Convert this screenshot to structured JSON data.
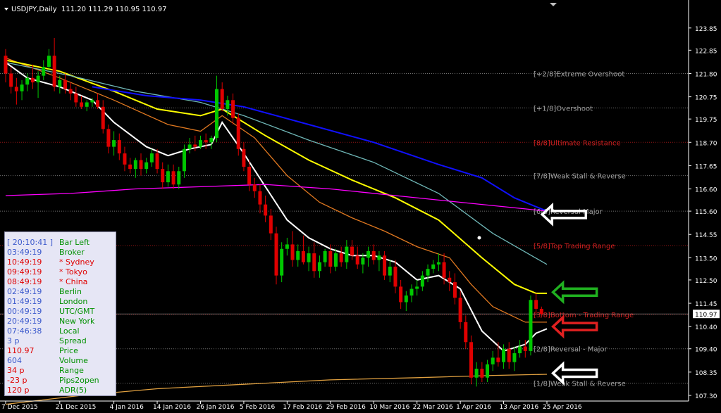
{
  "header": {
    "symbol_timeframe": "USDJPY,Daily",
    "ohlc": "111.20 111.29 110.95 110.97"
  },
  "colors": {
    "background": "#000000",
    "bull": "#00c800",
    "bear": "#e00000",
    "ma_fast": "#ffffff",
    "ma_orange": "#e07820",
    "ma_yellow": "#ffff00",
    "ma_teal": "#6fb7b7",
    "ma_blue": "#1010ff",
    "ma_magenta": "#ff00ff",
    "ma_long": "#e0a040",
    "axis_text": "#ffffff",
    "murrey_gray": "#a0a0a0",
    "murrey_red": "#d02020"
  },
  "chart_data": {
    "type": "candlestick",
    "y_range": [
      107.3,
      124.35
    ],
    "y_ticks": [
      123.85,
      122.85,
      121.8,
      120.75,
      119.75,
      118.7,
      117.65,
      116.6,
      115.6,
      114.55,
      113.5,
      112.5,
      111.45,
      110.4,
      109.4,
      108.35,
      107.3
    ],
    "y_tick_labels": [
      "123.85",
      "122.85",
      "121.80",
      "120.75",
      "119.75",
      "118.70",
      "117.65",
      "116.60",
      "115.60",
      "114.55",
      "113.50",
      "112.50",
      "111.45",
      "110.40",
      "109.40",
      "108.35",
      "107.30"
    ],
    "x_labels": [
      "7 Dec 2015",
      "21 Dec 2015",
      "4 Jan 2016",
      "14 Jan 2016",
      "26 Jan 2016",
      "5 Feb 2016",
      "17 Feb 2016",
      "29 Feb 2016",
      "10 Mar 2016",
      "22 Mar 2016",
      "1 Apr 2016",
      "13 Apr 2016",
      "25 Apr 2016"
    ],
    "x_label_index": [
      0,
      10,
      20,
      28,
      36,
      44,
      52,
      60,
      68,
      76,
      84,
      92,
      100
    ],
    "current_price": 110.97,
    "current_price_label": "110.97",
    "candles": [
      [
        122.6,
        122.9,
        121.4,
        121.8
      ],
      [
        121.8,
        122.1,
        120.9,
        121.2
      ],
      [
        121.2,
        121.6,
        120.4,
        121.0
      ],
      [
        121.0,
        121.5,
        120.6,
        121.3
      ],
      [
        121.3,
        121.8,
        121.0,
        121.6
      ],
      [
        121.6,
        122.2,
        121.1,
        121.4
      ],
      [
        121.4,
        121.9,
        120.7,
        121.7
      ],
      [
        121.7,
        122.4,
        121.5,
        122.1
      ],
      [
        122.1,
        122.9,
        121.9,
        122.6
      ],
      [
        122.6,
        123.4,
        121.0,
        121.2
      ],
      [
        121.2,
        121.7,
        120.9,
        121.5
      ],
      [
        121.5,
        121.8,
        120.9,
        121.1
      ],
      [
        121.1,
        121.4,
        120.6,
        120.9
      ],
      [
        120.9,
        121.2,
        120.3,
        120.5
      ],
      [
        120.5,
        120.8,
        120.2,
        120.3
      ],
      [
        120.3,
        120.6,
        120.1,
        120.5
      ],
      [
        120.5,
        120.7,
        120.3,
        120.6
      ],
      [
        120.6,
        120.9,
        120.2,
        120.3
      ],
      [
        120.3,
        120.6,
        119.1,
        119.3
      ],
      [
        119.3,
        119.5,
        118.2,
        118.5
      ],
      [
        118.5,
        119.2,
        118.1,
        118.8
      ],
      [
        118.8,
        119.1,
        117.9,
        118.2
      ],
      [
        118.2,
        118.5,
        117.4,
        117.7
      ],
      [
        117.7,
        118.0,
        117.3,
        117.5
      ],
      [
        117.5,
        118.0,
        117.1,
        117.9
      ],
      [
        117.9,
        118.2,
        117.2,
        117.5
      ],
      [
        117.5,
        118.0,
        117.3,
        117.8
      ],
      [
        117.8,
        118.4,
        117.6,
        118.2
      ],
      [
        118.2,
        118.4,
        117.3,
        117.5
      ],
      [
        117.5,
        117.8,
        116.6,
        116.9
      ],
      [
        116.9,
        117.7,
        116.7,
        117.4
      ],
      [
        117.4,
        117.7,
        116.6,
        116.8
      ],
      [
        116.8,
        117.6,
        116.6,
        117.4
      ],
      [
        117.4,
        118.6,
        117.1,
        118.4
      ],
      [
        118.4,
        118.9,
        118.2,
        118.6
      ],
      [
        118.6,
        119.0,
        118.3,
        118.5
      ],
      [
        118.5,
        119.0,
        118.4,
        118.8
      ],
      [
        118.8,
        119.1,
        118.4,
        118.7
      ],
      [
        118.7,
        119.0,
        118.4,
        118.9
      ],
      [
        118.9,
        121.7,
        118.7,
        121.1
      ],
      [
        121.1,
        121.4,
        120.1,
        120.2
      ],
      [
        120.2,
        120.8,
        119.9,
        120.6
      ],
      [
        120.6,
        120.9,
        119.5,
        119.8
      ],
      [
        119.8,
        120.0,
        118.1,
        118.4
      ],
      [
        118.4,
        118.7,
        117.4,
        117.6
      ],
      [
        117.6,
        117.9,
        116.5,
        116.8
      ],
      [
        116.8,
        117.1,
        116.2,
        116.5
      ],
      [
        116.5,
        116.8,
        115.5,
        115.9
      ],
      [
        115.9,
        116.3,
        115.1,
        115.4
      ],
      [
        115.4,
        115.7,
        114.3,
        114.6
      ],
      [
        114.6,
        114.9,
        112.3,
        112.7
      ],
      [
        112.7,
        114.2,
        112.4,
        113.9
      ],
      [
        113.9,
        114.4,
        113.6,
        114.1
      ],
      [
        114.1,
        114.7,
        113.1,
        113.4
      ],
      [
        113.4,
        114.1,
        113.1,
        113.8
      ],
      [
        113.8,
        114.5,
        113.2,
        113.3
      ],
      [
        113.3,
        114.0,
        112.9,
        113.7
      ],
      [
        113.7,
        114.2,
        112.6,
        112.9
      ],
      [
        112.9,
        113.6,
        112.6,
        113.3
      ],
      [
        113.3,
        113.9,
        113.1,
        113.8
      ],
      [
        113.8,
        114.1,
        112.8,
        113.1
      ],
      [
        113.1,
        113.9,
        112.9,
        113.7
      ],
      [
        113.7,
        114.0,
        113.1,
        113.3
      ],
      [
        113.3,
        114.3,
        113.0,
        114.0
      ],
      [
        114.0,
        114.3,
        113.4,
        113.6
      ],
      [
        113.6,
        114.0,
        113.0,
        113.2
      ],
      [
        113.2,
        113.7,
        112.8,
        113.5
      ],
      [
        113.5,
        114.0,
        113.1,
        113.8
      ],
      [
        113.8,
        114.1,
        113.2,
        113.4
      ],
      [
        113.4,
        113.8,
        112.9,
        113.6
      ],
      [
        113.6,
        113.8,
        112.5,
        112.7
      ],
      [
        112.7,
        113.4,
        112.4,
        113.1
      ],
      [
        113.1,
        113.4,
        111.9,
        112.2
      ],
      [
        112.2,
        112.5,
        111.2,
        111.5
      ],
      [
        111.5,
        112.0,
        111.1,
        111.8
      ],
      [
        111.8,
        112.3,
        111.5,
        112.1
      ],
      [
        112.1,
        112.5,
        111.8,
        112.2
      ],
      [
        112.2,
        112.9,
        112.0,
        112.7
      ],
      [
        112.7,
        113.2,
        112.4,
        113.0
      ],
      [
        113.0,
        113.4,
        112.8,
        113.2
      ],
      [
        113.2,
        113.7,
        112.9,
        113.3
      ],
      [
        113.3,
        113.7,
        112.3,
        112.6
      ],
      [
        112.6,
        112.9,
        112.0,
        112.4
      ],
      [
        112.4,
        112.8,
        111.4,
        111.7
      ],
      [
        111.7,
        112.0,
        110.3,
        110.6
      ],
      [
        110.6,
        110.9,
        109.4,
        109.7
      ],
      [
        109.7,
        110.0,
        107.8,
        108.1
      ],
      [
        108.1,
        108.8,
        107.7,
        108.5
      ],
      [
        108.5,
        108.8,
        107.9,
        108.1
      ],
      [
        108.1,
        108.9,
        107.9,
        108.7
      ],
      [
        108.7,
        109.3,
        108.4,
        109.0
      ],
      [
        109.0,
        109.7,
        108.6,
        108.8
      ],
      [
        108.8,
        109.6,
        108.5,
        109.4
      ],
      [
        109.4,
        109.7,
        108.5,
        108.8
      ],
      [
        108.8,
        109.5,
        108.4,
        109.2
      ],
      [
        109.2,
        109.8,
        109.0,
        109.5
      ],
      [
        109.5,
        109.8,
        109.0,
        109.3
      ],
      [
        109.3,
        111.8,
        109.1,
        111.6
      ],
      [
        111.6,
        111.9,
        110.9,
        111.2
      ],
      [
        111.2,
        111.3,
        110.9,
        110.97
      ]
    ],
    "moving_averages": [
      {
        "color_key": "ma_fast",
        "values": [
          [
            0,
            122.3
          ],
          [
            4,
            121.6
          ],
          [
            10,
            121.2
          ],
          [
            16,
            120.6
          ],
          [
            20,
            119.6
          ],
          [
            26,
            118.5
          ],
          [
            30,
            118.1
          ],
          [
            34,
            118.4
          ],
          [
            38,
            118.6
          ],
          [
            40,
            119.6
          ],
          [
            44,
            118.2
          ],
          [
            48,
            116.7
          ],
          [
            52,
            115.2
          ],
          [
            56,
            114.4
          ],
          [
            60,
            113.9
          ],
          [
            64,
            113.6
          ],
          [
            68,
            113.6
          ],
          [
            72,
            113.3
          ],
          [
            76,
            112.5
          ],
          [
            80,
            112.7
          ],
          [
            84,
            112.1
          ],
          [
            88,
            110.2
          ],
          [
            92,
            109.3
          ],
          [
            96,
            109.6
          ],
          [
            98,
            110.1
          ],
          [
            100,
            110.3
          ]
        ]
      },
      {
        "color_key": "ma_orange",
        "values": [
          [
            0,
            122.5
          ],
          [
            10,
            121.6
          ],
          [
            20,
            120.6
          ],
          [
            30,
            119.5
          ],
          [
            36,
            119.2
          ],
          [
            40,
            119.9
          ],
          [
            46,
            118.9
          ],
          [
            52,
            117.2
          ],
          [
            58,
            116.0
          ],
          [
            64,
            115.3
          ],
          [
            70,
            114.7
          ],
          [
            76,
            114.0
          ],
          [
            82,
            113.5
          ],
          [
            86,
            112.3
          ],
          [
            90,
            111.3
          ],
          [
            96,
            110.6
          ],
          [
            100,
            110.6
          ]
        ]
      },
      {
        "color_key": "ma_yellow",
        "values": [
          [
            0,
            122.4
          ],
          [
            10,
            121.9
          ],
          [
            20,
            121.0
          ],
          [
            28,
            120.2
          ],
          [
            36,
            119.9
          ],
          [
            40,
            120.2
          ],
          [
            48,
            119.0
          ],
          [
            56,
            117.9
          ],
          [
            64,
            117.0
          ],
          [
            72,
            116.2
          ],
          [
            80,
            115.2
          ],
          [
            88,
            113.5
          ],
          [
            94,
            112.3
          ],
          [
            98,
            111.9
          ],
          [
            100,
            111.9
          ]
        ]
      },
      {
        "color_key": "ma_teal",
        "values": [
          [
            0,
            122.3
          ],
          [
            12,
            121.7
          ],
          [
            24,
            121.0
          ],
          [
            36,
            120.5
          ],
          [
            44,
            119.9
          ],
          [
            56,
            118.8
          ],
          [
            68,
            117.8
          ],
          [
            80,
            116.4
          ],
          [
            90,
            114.6
          ],
          [
            100,
            113.2
          ]
        ]
      },
      {
        "color_key": "ma_blue",
        "values": [
          [
            16,
            121.2
          ],
          [
            26,
            120.8
          ],
          [
            36,
            120.6
          ],
          [
            44,
            120.3
          ],
          [
            56,
            119.5
          ],
          [
            68,
            118.7
          ],
          [
            80,
            117.7
          ],
          [
            88,
            117.1
          ],
          [
            94,
            116.2
          ],
          [
            100,
            115.6
          ]
        ]
      },
      {
        "color_key": "ma_magenta",
        "values": [
          [
            0,
            116.3
          ],
          [
            12,
            116.4
          ],
          [
            24,
            116.6
          ],
          [
            36,
            116.7
          ],
          [
            48,
            116.8
          ],
          [
            60,
            116.6
          ],
          [
            72,
            116.3
          ],
          [
            84,
            116.0
          ],
          [
            96,
            115.7
          ],
          [
            100,
            115.6
          ]
        ]
      },
      {
        "color_key": "ma_long",
        "values": [
          [
            0,
            106.9
          ],
          [
            14,
            107.3
          ],
          [
            28,
            107.6
          ],
          [
            44,
            107.8
          ],
          [
            60,
            108.0
          ],
          [
            76,
            108.1
          ],
          [
            90,
            108.2
          ],
          [
            100,
            108.25
          ]
        ]
      }
    ],
    "murrey_levels": [
      {
        "price": 121.8,
        "label": "[+2/8]Extreme Overshoot",
        "color_key": "murrey_gray"
      },
      {
        "price": 120.25,
        "label": "[+1/8]Overshoot",
        "color_key": "murrey_gray"
      },
      {
        "price": 118.7,
        "label": "[8/8]Ultimate Resistance",
        "color_key": "murrey_red"
      },
      {
        "price": 117.2,
        "label": "[7/8]Weak Stall & Reverse",
        "color_key": "murrey_gray"
      },
      {
        "price": 115.6,
        "label": "[6/8]Reversal Major",
        "color_key": "murrey_gray"
      },
      {
        "price": 114.05,
        "label": "[5/8]Top Trading Range",
        "color_key": "murrey_red"
      },
      {
        "price": 110.95,
        "label": "[3/8]Bottom - Trading Range",
        "color_key": "murrey_red"
      },
      {
        "price": 109.4,
        "label": "[2/8]Reversal - Major",
        "color_key": "murrey_gray"
      },
      {
        "price": 107.85,
        "label": "[1/8]Weak Stall & Reverse",
        "color_key": "murrey_gray"
      }
    ]
  },
  "info_panel": {
    "rows": [
      {
        "time": "[ 20:10:41 ]",
        "name": "Bar Left",
        "color": "#3c5acc",
        "name_color": "#009000"
      },
      {
        "time": "03:49:19",
        "name": "Broker",
        "color": "#3c5acc",
        "name_color": "#009000"
      },
      {
        "time": "10:49:19",
        "name": "* Sydney",
        "color": "#e00000",
        "name_color": "#e00000"
      },
      {
        "time": "09:49:19",
        "name": "* Tokyo",
        "color": "#e00000",
        "name_color": "#e00000"
      },
      {
        "time": "08:49:19",
        "name": "* China",
        "color": "#e00000",
        "name_color": "#e00000"
      },
      {
        "time": "02:49:19",
        "name": "Berlin",
        "color": "#3c5acc",
        "name_color": "#009000"
      },
      {
        "time": "01:49:19",
        "name": "London",
        "color": "#3c5acc",
        "name_color": "#009000"
      },
      {
        "time": "00:49:19",
        "name": "UTC/GMT",
        "color": "#3c5acc",
        "name_color": "#009000"
      },
      {
        "time": "20:49:19",
        "name": "New York",
        "color": "#3c5acc",
        "name_color": "#009000"
      },
      {
        "time": "07:46:38",
        "name": "Local",
        "color": "#3c5acc",
        "name_color": "#009000"
      },
      {
        "time": "3 p",
        "name": "Spread",
        "color": "#3c5acc",
        "name_color": "#009000"
      },
      {
        "time": "110.97",
        "name": "Price",
        "color": "#e00000",
        "name_color": "#009000"
      },
      {
        "time": "604",
        "name": "Volume",
        "color": "#3c5acc",
        "name_color": "#009000"
      },
      {
        "time": "34 p",
        "name": "Range",
        "color": "#e00000",
        "name_color": "#009000"
      },
      {
        "time": "-23 p",
        "name": "Pips2open",
        "color": "#e00000",
        "name_color": "#009000"
      },
      {
        "time": "120 p",
        "name": "ADR(5)",
        "color": "#e00000",
        "name_color": "#009000"
      }
    ]
  },
  "annotations": {
    "arrows": [
      {
        "name": "white-arrow-reversal-major",
        "color": "#ffffff",
        "price": 115.45,
        "index": 96
      },
      {
        "name": "green-arrow-yellow-ma",
        "color": "#20b020",
        "price": 111.95,
        "index": 98
      },
      {
        "name": "red-arrow-trading-range",
        "color": "#e02020",
        "price": 110.4,
        "index": 98
      },
      {
        "name": "white-arrow-long-ma",
        "color": "#ffffff",
        "price": 108.3,
        "index": 98
      }
    ]
  }
}
